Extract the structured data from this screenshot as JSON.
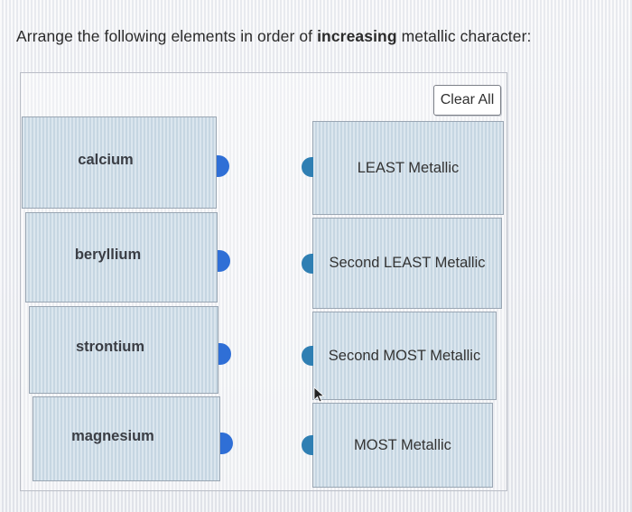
{
  "instruction": {
    "prefix": "Arrange the following elements in order of ",
    "emphasis": "increasing",
    "suffix": " metallic character:"
  },
  "clear_button": {
    "label": "Clear All"
  },
  "elements": [
    {
      "label": "calcium"
    },
    {
      "label": "beryllium"
    },
    {
      "label": "strontium"
    },
    {
      "label": "magnesium"
    }
  ],
  "targets": [
    {
      "label": "LEAST Metallic"
    },
    {
      "label": "Second LEAST Metallic"
    },
    {
      "label": "Second MOST Metallic"
    },
    {
      "label": "MOST Metallic"
    }
  ],
  "colors": {
    "tile": "#cfdee8",
    "element_tab": "#2f6fd6",
    "target_tab": "#2f7fb3"
  },
  "icons": {
    "drag_handle": "puzzle-tab-icon",
    "pointer": "mouse-pointer-icon"
  }
}
